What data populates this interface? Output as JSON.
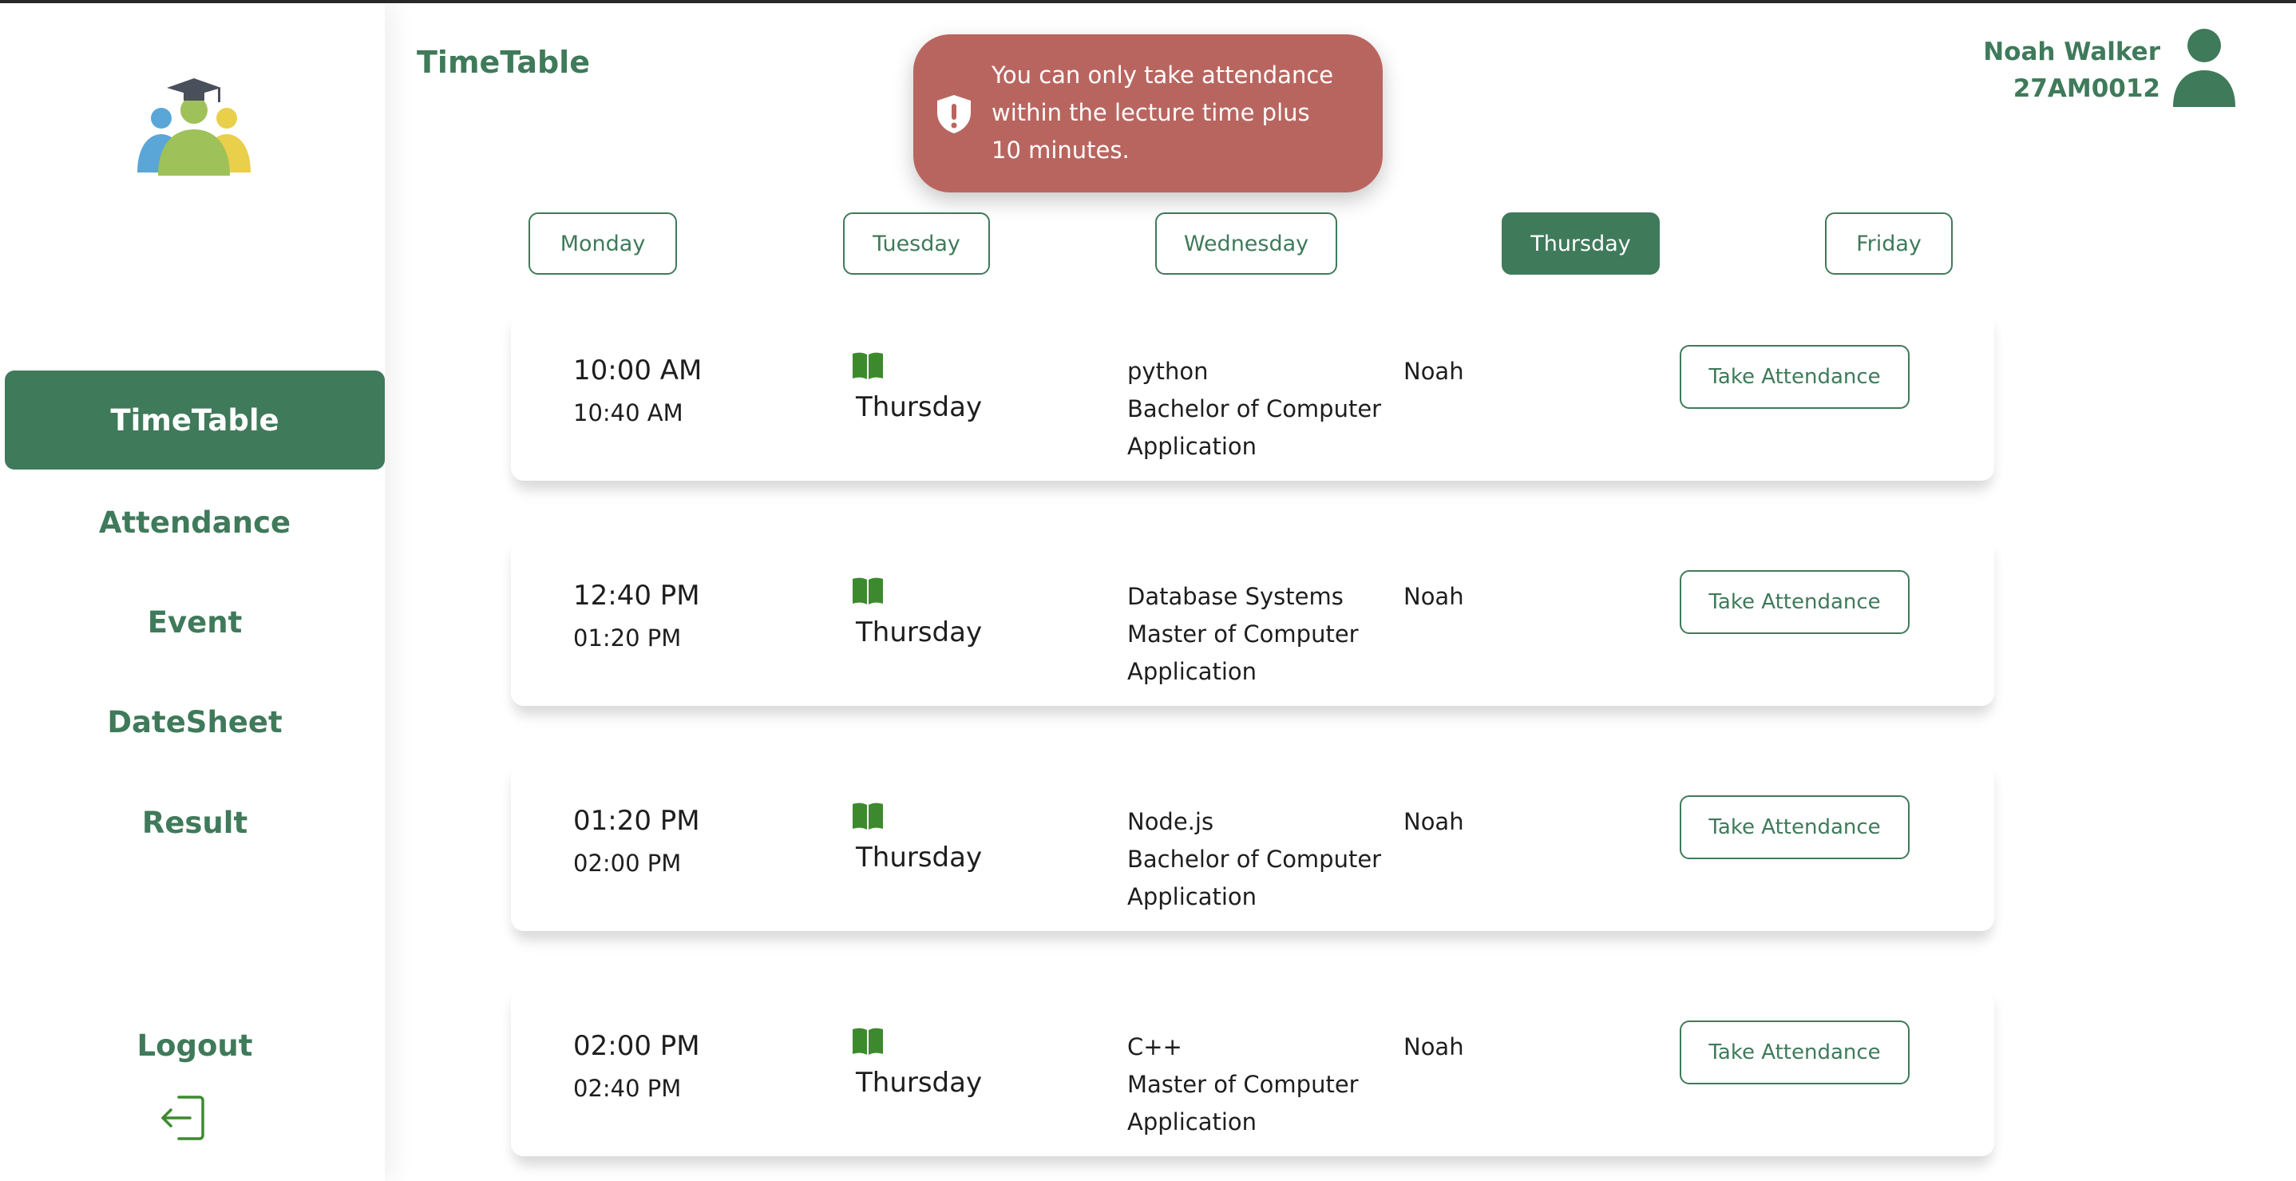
{
  "header": {
    "title": "TimeTable"
  },
  "user": {
    "name": "Noah Walker",
    "id": "27AM0012"
  },
  "toast": {
    "message": "You can only take attendance within the lecture time plus 10 minutes."
  },
  "sidebar": {
    "items": [
      {
        "label": "TimeTable",
        "active": true
      },
      {
        "label": "Attendance",
        "active": false
      },
      {
        "label": "Event",
        "active": false
      },
      {
        "label": "DateSheet",
        "active": false
      },
      {
        "label": "Result",
        "active": false
      }
    ],
    "logout_label": "Logout"
  },
  "days": [
    {
      "label": "Monday",
      "active": false
    },
    {
      "label": "Tuesday",
      "active": false
    },
    {
      "label": "Wednesday",
      "active": false
    },
    {
      "label": "Thursday",
      "active": true
    },
    {
      "label": "Friday",
      "active": false
    }
  ],
  "lectures": [
    {
      "start": "10:00 AM",
      "end": "10:40 AM",
      "day": "Thursday",
      "subject": "python",
      "course": "Bachelor of Computer Application",
      "teacher": "Noah",
      "button": "Take Attendance"
    },
    {
      "start": "12:40 PM",
      "end": "01:20 PM",
      "day": "Thursday",
      "subject": "Database Systems",
      "course": "Master of Computer Application",
      "teacher": "Noah",
      "button": "Take Attendance"
    },
    {
      "start": "01:20 PM",
      "end": "02:00 PM",
      "day": "Thursday",
      "subject": "Node.js",
      "course": "Bachelor of Computer Application",
      "teacher": "Noah",
      "button": "Take Attendance"
    },
    {
      "start": "02:00 PM",
      "end": "02:40 PM",
      "day": "Thursday",
      "subject": "C++",
      "course": "Master of Computer Application",
      "teacher": "Noah",
      "button": "Take Attendance"
    }
  ],
  "colors": {
    "primary": "#3f7a5a",
    "toast": "#b9655f",
    "book_icon": "#3d8a2e"
  },
  "icons": {
    "logo": "students-graduation-logo",
    "book": "book-open-icon",
    "toast": "shield-alert-icon",
    "logout": "logout-arrow-icon",
    "avatar": "user-avatar-icon"
  }
}
